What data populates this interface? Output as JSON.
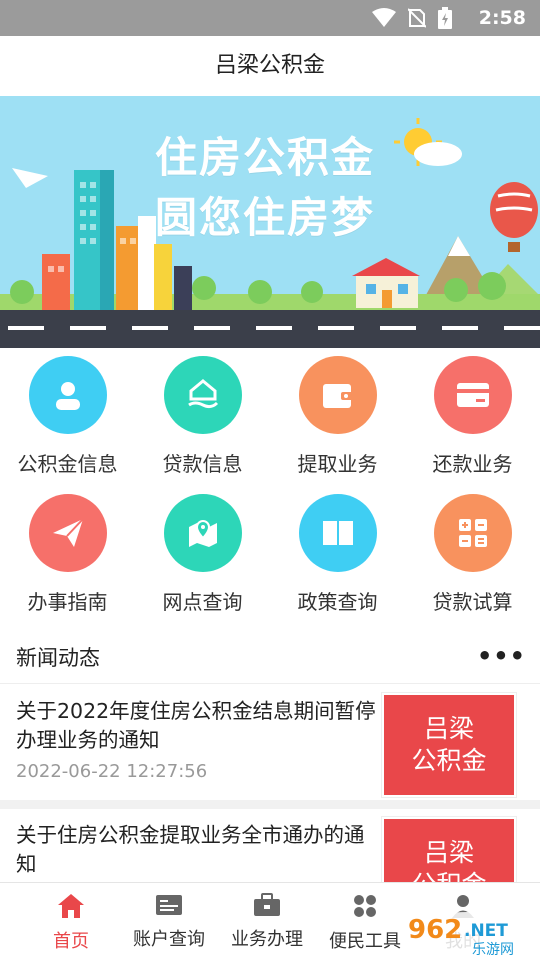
{
  "status_bar": {
    "time": "2:58",
    "icons": [
      "wifi-icon",
      "no-sim-icon",
      "battery-charging-icon"
    ]
  },
  "app": {
    "title": "吕梁公积金"
  },
  "banner": {
    "line1": "住房公积金",
    "line2": "圆您住房梦"
  },
  "features": [
    {
      "label": "公积金信息",
      "icon": "user-icon",
      "color": "#3fcef3"
    },
    {
      "label": "贷款信息",
      "icon": "house-hand-icon",
      "color": "#2dd6b8"
    },
    {
      "label": "提取业务",
      "icon": "wallet-icon",
      "color": "#f8925e"
    },
    {
      "label": "还款业务",
      "icon": "card-icon",
      "color": "#f6706a"
    },
    {
      "label": "办事指南",
      "icon": "paper-plane-icon",
      "color": "#f6706a"
    },
    {
      "label": "网点查询",
      "icon": "map-pin-icon",
      "color": "#2dd6b8"
    },
    {
      "label": "政策查询",
      "icon": "book-icon",
      "color": "#3fcef3"
    },
    {
      "label": "贷款试算",
      "icon": "calculator-icon",
      "color": "#f8925e"
    }
  ],
  "news": {
    "section_title": "新闻动态",
    "more": "•••",
    "items": [
      {
        "title": "关于2022年度住房公积金结息期间暂停办理业务的通知",
        "date": "2022-06-22 12:27:56",
        "thumb_line1": "吕梁",
        "thumb_line2": "公积金"
      },
      {
        "title": "关于住房公积金提取业务全市通办的通知",
        "date": "",
        "thumb_line1": "吕梁",
        "thumb_line2": "公积金"
      }
    ]
  },
  "tabs": [
    {
      "label": "首页",
      "icon": "home-icon",
      "active": true
    },
    {
      "label": "账户查询",
      "icon": "id-card-icon",
      "active": false
    },
    {
      "label": "业务办理",
      "icon": "briefcase-icon",
      "active": false
    },
    {
      "label": "便民工具",
      "icon": "apps-icon",
      "active": false
    },
    {
      "label": "我的",
      "icon": "profile-icon",
      "active": false
    }
  ],
  "watermark": {
    "text1": "962",
    "text2": ".NET",
    "text3": "乐游网"
  },
  "colors": {
    "accent": "#e9474a",
    "status_bar": "#9b9b9b",
    "sky": "#9ee0f4"
  }
}
